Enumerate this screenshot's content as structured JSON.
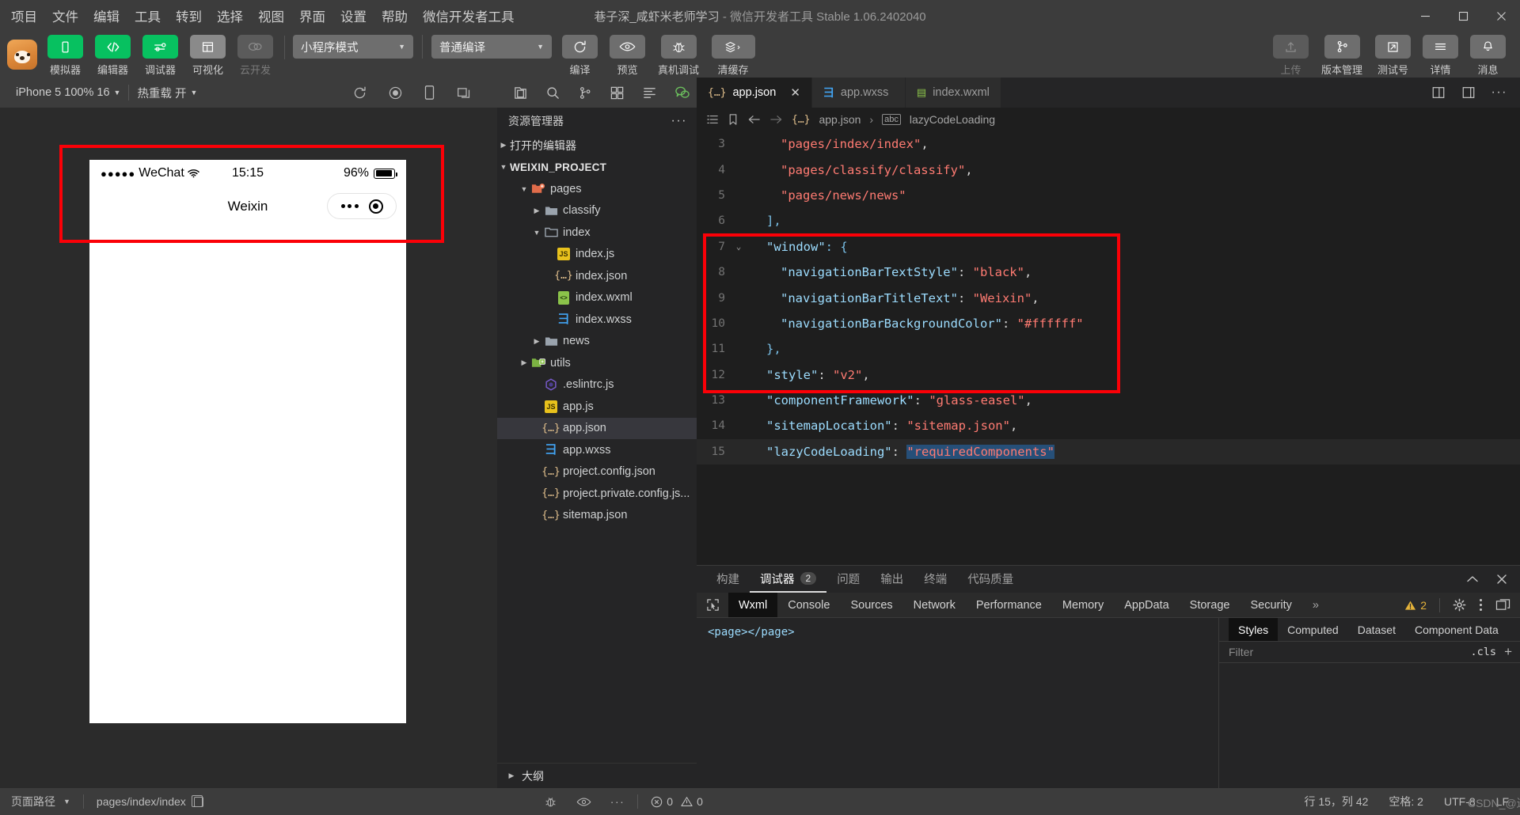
{
  "window": {
    "title_project": "巷子深_咸虾米老师学习",
    "title_sep": " - ",
    "title_app": "微信开发者工具 Stable 1.06.2402040",
    "controls": [
      "minimize",
      "maximize",
      "close"
    ]
  },
  "menubar": {
    "items": [
      "项目",
      "文件",
      "编辑",
      "工具",
      "转到",
      "选择",
      "视图",
      "界面",
      "设置",
      "帮助",
      "微信开发者工具"
    ]
  },
  "toolbar": {
    "left_buttons": [
      {
        "label": "模拟器",
        "icon": "phone-icon",
        "style": "green"
      },
      {
        "label": "编辑器",
        "icon": "code-icon",
        "style": "green"
      },
      {
        "label": "调试器",
        "icon": "sliders-icon",
        "style": "green"
      },
      {
        "label": "可视化",
        "icon": "layout-icon",
        "style": "grey"
      },
      {
        "label": "云开发",
        "icon": "cloud-icon",
        "style": "dim"
      }
    ],
    "mode_select": "小程序模式",
    "compile_select": "普通编译",
    "mid_buttons": [
      {
        "label": "编译",
        "icon": "refresh-icon"
      },
      {
        "label": "预览",
        "icon": "eye-icon"
      },
      {
        "label": "真机调试",
        "icon": "bug-icon"
      },
      {
        "label": "清缓存",
        "icon": "layers-icon"
      }
    ],
    "right_buttons": [
      {
        "label": "上传",
        "icon": "upload-icon",
        "dim": true
      },
      {
        "label": "版本管理",
        "icon": "branch-icon",
        "dim": false
      },
      {
        "label": "测试号",
        "icon": "external-link-icon",
        "dim": false
      },
      {
        "label": "详情",
        "icon": "menu-icon",
        "dim": false
      },
      {
        "label": "消息",
        "icon": "bell-icon",
        "dim": false
      }
    ]
  },
  "simulator": {
    "device_select": "iPhone 5 100% 16",
    "hotreload_select": "热重载 开",
    "icons": [
      "refresh-icon",
      "record-icon",
      "device-icon",
      "multiscreen-icon"
    ],
    "phone": {
      "carrier": "WeChat",
      "signal_dots": "●●●●●",
      "time": "15:15",
      "battery_percent": "96%",
      "nav_title": "Weixin"
    }
  },
  "explorer": {
    "icon_row": [
      "files-icon",
      "search-icon",
      "source-control-icon",
      "extensions-icon",
      "outline-icon",
      "wechat-icon"
    ],
    "header": "资源管理器",
    "more": "···",
    "open_editors": "打开的编辑器",
    "project_root": "WEIXIN_PROJECT",
    "outline": "大纲",
    "tree": [
      {
        "name": "pages",
        "type": "folder-pages",
        "depth": 1,
        "twisty": "open"
      },
      {
        "name": "classify",
        "type": "folder",
        "depth": 2,
        "twisty": "closed"
      },
      {
        "name": "index",
        "type": "folder-open",
        "depth": 2,
        "twisty": "open"
      },
      {
        "name": "index.js",
        "type": "js",
        "depth": 3,
        "twisty": "none"
      },
      {
        "name": "index.json",
        "type": "json",
        "depth": 3,
        "twisty": "none"
      },
      {
        "name": "index.wxml",
        "type": "wxml",
        "depth": 3,
        "twisty": "none"
      },
      {
        "name": "index.wxss",
        "type": "wxss",
        "depth": 3,
        "twisty": "none"
      },
      {
        "name": "news",
        "type": "folder",
        "depth": 2,
        "twisty": "closed"
      },
      {
        "name": "utils",
        "type": "folder-utils",
        "depth": 1,
        "twisty": "closed"
      },
      {
        "name": ".eslintrc.js",
        "type": "eslint",
        "depth": 2,
        "twisty": "none"
      },
      {
        "name": "app.js",
        "type": "js",
        "depth": 2,
        "twisty": "none"
      },
      {
        "name": "app.json",
        "type": "json",
        "depth": 2,
        "twisty": "none",
        "selected": true
      },
      {
        "name": "app.wxss",
        "type": "wxss",
        "depth": 2,
        "twisty": "none"
      },
      {
        "name": "project.config.json",
        "type": "json",
        "depth": 2,
        "twisty": "none"
      },
      {
        "name": "project.private.config.js...",
        "type": "json",
        "depth": 2,
        "twisty": "none"
      },
      {
        "name": "sitemap.json",
        "type": "json",
        "depth": 2,
        "twisty": "none"
      }
    ]
  },
  "editor": {
    "tabs": [
      {
        "label": "app.json",
        "icon": "json-icon",
        "active": true,
        "closable": true
      },
      {
        "label": "app.wxss",
        "icon": "wxss-icon",
        "active": false,
        "closable": false
      },
      {
        "label": "index.wxml",
        "icon": "wxml-icon",
        "active": false,
        "closable": false
      }
    ],
    "tab_actions": [
      "split-editor-icon",
      "layout-icon",
      "more-icon"
    ],
    "breadcrumb": {
      "file": "app.json",
      "symbol": "lazyCodeLoading",
      "separator": "›"
    },
    "lines": [
      {
        "num": "3",
        "indent": 2,
        "tokens": [
          {
            "t": "\"pages/index/index\"",
            "c": "s"
          },
          {
            "t": ",",
            "c": "p"
          }
        ]
      },
      {
        "num": "4",
        "indent": 2,
        "tokens": [
          {
            "t": "\"pages/classify/classify\"",
            "c": "s"
          },
          {
            "t": ",",
            "c": "p"
          }
        ]
      },
      {
        "num": "5",
        "indent": 2,
        "tokens": [
          {
            "t": "\"pages/news/news\"",
            "c": "s"
          }
        ]
      },
      {
        "num": "6",
        "indent": 1,
        "tokens": [
          {
            "t": "],",
            "c": "b"
          }
        ]
      },
      {
        "num": "7",
        "indent": 1,
        "fold": "chevron-down",
        "tokens": [
          {
            "t": "\"window\"",
            "c": "k"
          },
          {
            "t": ": {",
            "c": "b"
          }
        ]
      },
      {
        "num": "8",
        "indent": 2,
        "tokens": [
          {
            "t": "\"navigationBarTextStyle\"",
            "c": "k"
          },
          {
            "t": ": ",
            "c": "p"
          },
          {
            "t": "\"black\"",
            "c": "s"
          },
          {
            "t": ",",
            "c": "p"
          }
        ]
      },
      {
        "num": "9",
        "indent": 2,
        "tokens": [
          {
            "t": "\"navigationBarTitleText\"",
            "c": "k"
          },
          {
            "t": ": ",
            "c": "p"
          },
          {
            "t": "\"Weixin\"",
            "c": "s"
          },
          {
            "t": ",",
            "c": "p"
          }
        ]
      },
      {
        "num": "10",
        "indent": 2,
        "tokens": [
          {
            "t": "\"navigationBarBackgroundColor\"",
            "c": "k"
          },
          {
            "t": ": ",
            "c": "p"
          },
          {
            "t": "\"#ffffff\"",
            "c": "s"
          }
        ]
      },
      {
        "num": "11",
        "indent": 1,
        "tokens": [
          {
            "t": "},",
            "c": "b"
          }
        ]
      },
      {
        "num": "12",
        "indent": 1,
        "tokens": [
          {
            "t": "\"style\"",
            "c": "k"
          },
          {
            "t": ": ",
            "c": "p"
          },
          {
            "t": "\"v2\"",
            "c": "s"
          },
          {
            "t": ",",
            "c": "p"
          }
        ]
      },
      {
        "num": "13",
        "indent": 1,
        "tokens": [
          {
            "t": "\"componentFramework\"",
            "c": "k"
          },
          {
            "t": ": ",
            "c": "p"
          },
          {
            "t": "\"glass-easel\"",
            "c": "s"
          },
          {
            "t": ",",
            "c": "p"
          }
        ]
      },
      {
        "num": "14",
        "indent": 1,
        "tokens": [
          {
            "t": "\"sitemapLocation\"",
            "c": "k"
          },
          {
            "t": ": ",
            "c": "p"
          },
          {
            "t": "\"sitemap.json\"",
            "c": "s"
          },
          {
            "t": ",",
            "c": "p"
          }
        ]
      },
      {
        "num": "15",
        "indent": 1,
        "current": true,
        "tokens": [
          {
            "t": "\"lazyCodeLoading\"",
            "c": "k"
          },
          {
            "t": ": ",
            "c": "p"
          },
          {
            "t": "\"requiredComponents\"",
            "c": "s",
            "sel": true
          }
        ]
      }
    ]
  },
  "debugger": {
    "tabs": [
      {
        "label": "构建",
        "active": false
      },
      {
        "label": "调试器",
        "active": true,
        "badge": "2"
      },
      {
        "label": "问题",
        "active": false
      },
      {
        "label": "输出",
        "active": false
      },
      {
        "label": "终端",
        "active": false
      },
      {
        "label": "代码质量",
        "active": false
      }
    ],
    "panel_controls": [
      "collapse-icon",
      "close-icon"
    ],
    "devtool_tabs": [
      {
        "label": "Wxml",
        "active": true
      },
      {
        "label": "Console",
        "active": false
      },
      {
        "label": "Sources",
        "active": false
      },
      {
        "label": "Network",
        "active": false
      },
      {
        "label": "Performance",
        "active": false
      },
      {
        "label": "Memory",
        "active": false
      },
      {
        "label": "AppData",
        "active": false
      },
      {
        "label": "Storage",
        "active": false
      },
      {
        "label": "Security",
        "active": false
      }
    ],
    "overflow": "»",
    "warning_count": "2",
    "wxml_content": "<page></page>",
    "styles_tabs": [
      {
        "label": "Styles",
        "active": true
      },
      {
        "label": "Computed",
        "active": false
      },
      {
        "label": "Dataset",
        "active": false
      },
      {
        "label": "Component Data",
        "active": false
      }
    ],
    "filter_placeholder": "Filter",
    "cls_label": ".cls",
    "plus": "+"
  },
  "statusbar": {
    "page_path_label": "页面路径",
    "page_path_value": "pages/index/index",
    "copy_icon": "copy-icon",
    "mid_icons": [
      "bug-icon",
      "eye-icon",
      "more-icon"
    ],
    "error_count": "0",
    "warning_count": "0",
    "cursor_position": "行 15，列 42",
    "spaces": "空格: 2",
    "encoding": "UTF-8",
    "line_ending": "LF",
    "watermark": "CSDN_@进步司"
  },
  "highlights": {
    "accent_red": "#fb0007",
    "accent_green": "#07c160"
  }
}
